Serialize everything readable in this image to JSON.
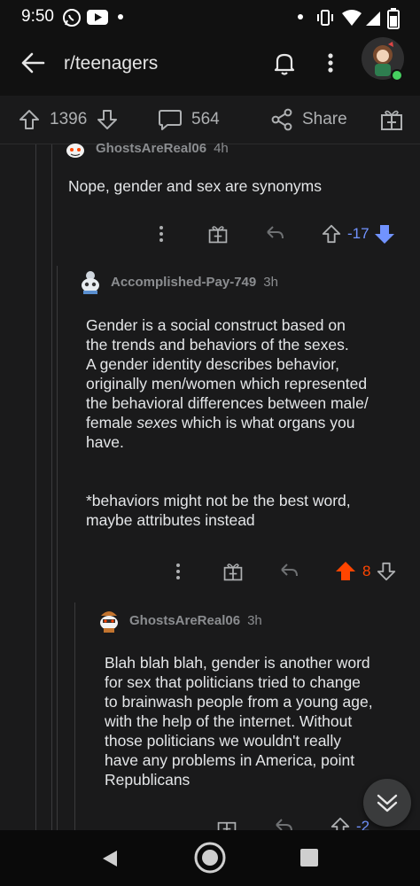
{
  "status_bar": {
    "time": "9:50",
    "icons": [
      "whatsapp-icon",
      "youtube-icon",
      "dot-icon",
      "dot-icon",
      "vibrate-icon",
      "wifi-icon",
      "signal-icon",
      "battery-icon"
    ]
  },
  "header": {
    "title": "r/teenagers",
    "icons": [
      "back-arrow-icon",
      "bell-icon",
      "kebab-menu-icon",
      "user-avatar"
    ]
  },
  "post_actions": {
    "upvotes": "1396",
    "comments": "564",
    "share_label": "Share"
  },
  "comments": [
    {
      "author": "GhostsAreReal06",
      "age": "4h",
      "body": "Nope,  gender and sex are synonyms",
      "score": "-17",
      "vote_state": "downvoted"
    },
    {
      "author": "Accomplished-Pay-749",
      "age": "3h",
      "body_lines": [
        "Gender is a social construct based on",
        "the trends and behaviors of the sexes.",
        "A gender identity describes behavior,",
        "originally men/women which represented",
        "the behavioral differences between male/"
      ],
      "body_line6_pre": "female ",
      "body_line6_em": "sexes",
      "body_line6_post": " which is what organs you",
      "body_line7": "have.",
      "footnote_lines": [
        "*behaviors might not be the best word,",
        "maybe attributes instead"
      ],
      "score": "8",
      "vote_state": "upvoted"
    },
    {
      "author": "GhostsAreReal06",
      "age": "3h",
      "body_lines": [
        "Blah blah blah, gender is another word",
        "for sex that politicians tried to change",
        "to brainwash people from a young age,",
        "with the help of the internet.  Without",
        "those politicians we wouldn't really",
        "have any problems in America,  point",
        "Republicans"
      ],
      "score": "-2",
      "vote_state": "downvoted"
    }
  ],
  "colors": {
    "upvote": "#ff4500",
    "downvote": "#7193ff",
    "background": "#1a1a1b"
  },
  "nav_bar": {
    "buttons": [
      "back-triangle-icon",
      "home-circle-icon",
      "recents-square-icon"
    ]
  }
}
